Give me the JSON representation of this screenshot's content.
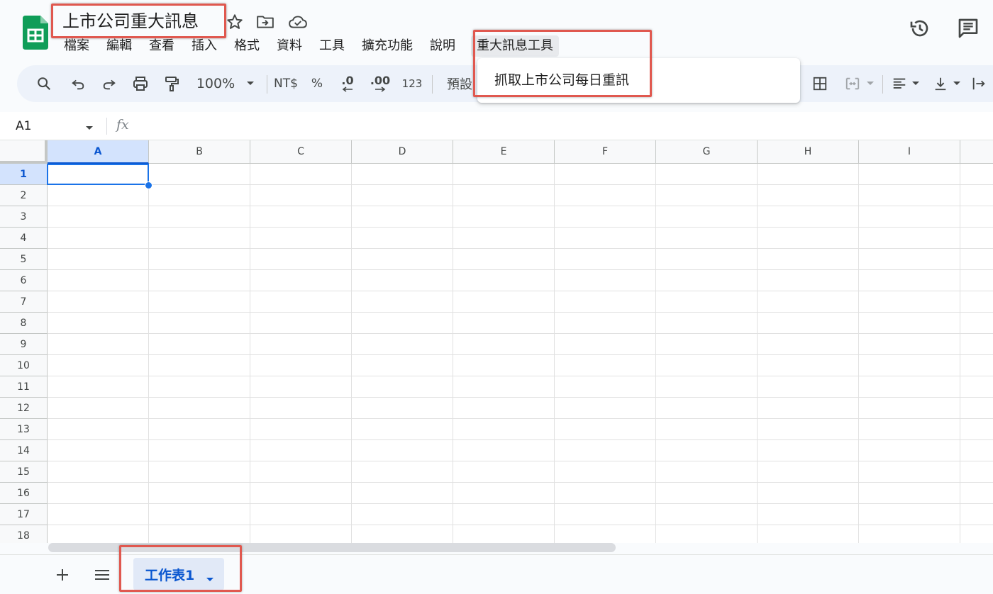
{
  "document": {
    "title": "上市公司重大訊息"
  },
  "menubar": {
    "items": [
      "檔案",
      "編輯",
      "查看",
      "插入",
      "格式",
      "資料",
      "工具",
      "擴充功能",
      "說明",
      "重大訊息工具"
    ]
  },
  "toolbar": {
    "zoom": "100%",
    "currency": "NT$",
    "percent": "%",
    "decrease_decimal": ".0",
    "increase_decimal": ".00",
    "number_format": "123",
    "font": "預設"
  },
  "dropdown": {
    "items": [
      "抓取上市公司每日重訊"
    ]
  },
  "formula_bar": {
    "name_box": "A1",
    "fx": "fx"
  },
  "grid": {
    "columns": [
      "A",
      "B",
      "C",
      "D",
      "E",
      "F",
      "G",
      "H",
      "I"
    ],
    "rows": [
      "1",
      "2",
      "3",
      "4",
      "5",
      "6",
      "7",
      "8",
      "9",
      "10",
      "11",
      "12",
      "13",
      "14",
      "15",
      "16",
      "17",
      "18"
    ],
    "selected_cell": "A1"
  },
  "sheets": {
    "tabs": [
      "工作表1"
    ]
  },
  "colors": {
    "accent": "#0b57d0",
    "annotation": "#e0584f",
    "logo": "#0f9d58"
  }
}
